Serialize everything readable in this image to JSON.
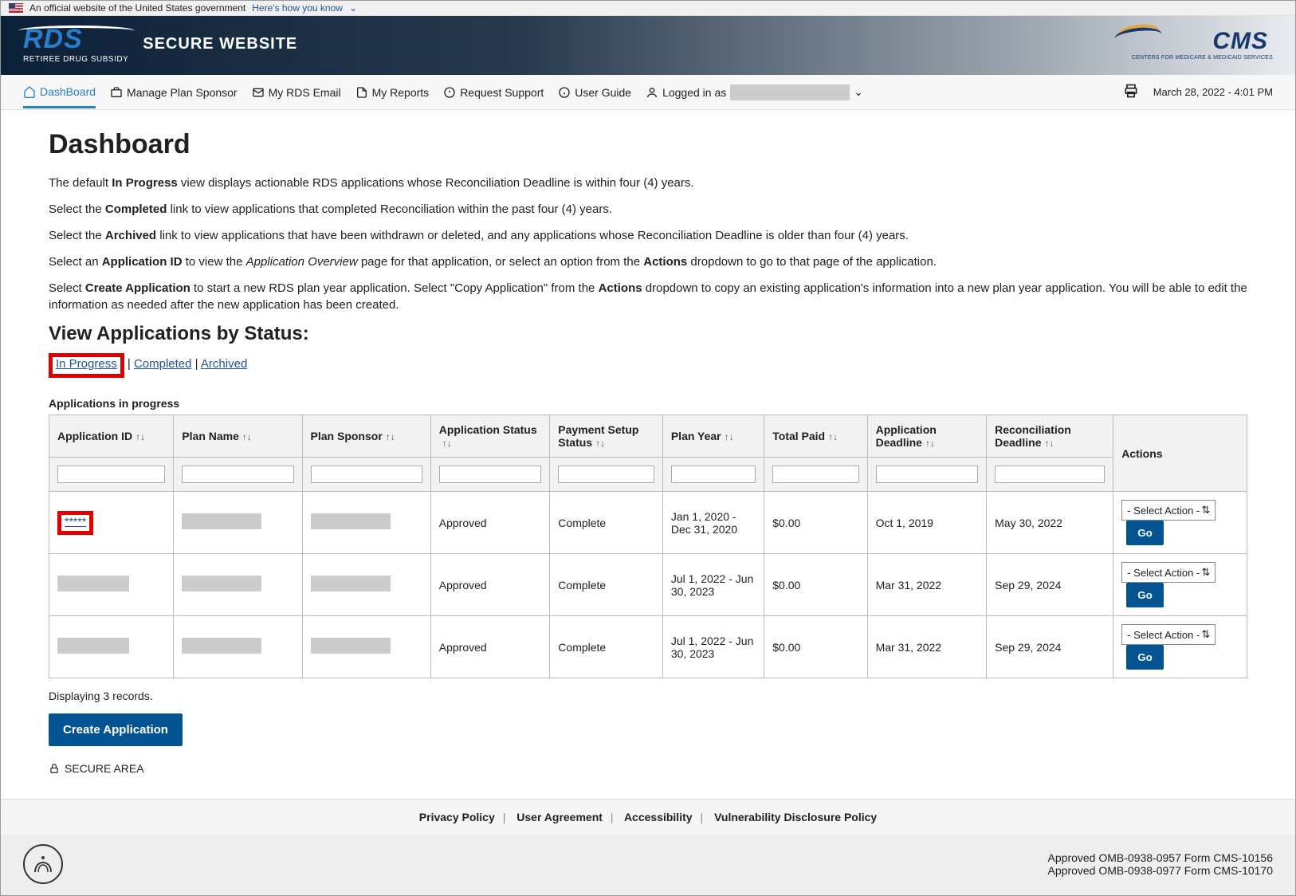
{
  "banner": {
    "official": "An official website of the United States government",
    "how": "Here's how you know"
  },
  "brand": {
    "logo_main": "RDS",
    "logo_sub": "RETIREE DRUG SUBSIDY",
    "site": "SECURE WEBSITE",
    "cms": "CMS",
    "cms_tag": "CENTERS FOR MEDICARE & MEDICAID SERVICES"
  },
  "nav": {
    "dashboard": "DashBoard",
    "manage": "Manage Plan Sponsor",
    "email": "My RDS Email",
    "reports": "My Reports",
    "support": "Request Support",
    "guide": "User Guide",
    "logged": "Logged in as",
    "timestamp": "March 28, 2022 - 4:01 PM"
  },
  "dash": {
    "title": "Dashboard",
    "p1a": "The default ",
    "p1b": "In Progress",
    "p1c": " view displays actionable RDS applications whose Reconciliation Deadline is within four (4) years.",
    "p2a": "Select the ",
    "p2b": "Completed",
    "p2c": " link to view applications that completed Reconciliation within the past four (4) years.",
    "p3a": "Select the ",
    "p3b": "Archived",
    "p3c": " link to view applications that have been withdrawn or deleted, and any applications whose Reconciliation Deadline is older than four (4) years.",
    "p4a": "Select an ",
    "p4b": "Application ID",
    "p4c": " to view the ",
    "p4d": "Application Overview",
    "p4e": " page for that application, or select an option from the ",
    "p4f": "Actions",
    "p4g": " dropdown to go to that page of the application.",
    "p5a": "Select ",
    "p5b": "Create Application",
    "p5c": " to start a new RDS plan year application. Select \"Copy Application\" from the ",
    "p5d": "Actions",
    "p5e": " dropdown to copy an existing application's information into a new plan year application. You will be able to edit the information as needed after the new application has been created.",
    "view_h": "View Applications by Status:",
    "links": {
      "inprog": "In Progress",
      "completed": "Completed",
      "archived": "Archived"
    },
    "caption": "Applications in progress"
  },
  "table": {
    "headers": {
      "appid": "Application ID",
      "plan": "Plan Name",
      "sponsor": "Plan Sponsor",
      "appstatus": "Application Status",
      "paystatus": "Payment Setup Status",
      "year": "Plan Year",
      "paid": "Total Paid",
      "appdead": "Application Deadline",
      "recdead": "Reconciliation Deadline",
      "actions": "Actions"
    },
    "select_placeholder": "- Select Action -",
    "go": "Go",
    "rows": [
      {
        "id": "*****",
        "status": "Approved",
        "pay": "Complete",
        "year": "Jan 1, 2020 - Dec 31, 2020",
        "paid": "$0.00",
        "appdead": "Oct 1, 2019",
        "recdead": "May 30, 2022"
      },
      {
        "id": "",
        "status": "Approved",
        "pay": "Complete",
        "year": "Jul 1, 2022 - Jun 30, 2023",
        "paid": "$0.00",
        "appdead": "Mar 31, 2022",
        "recdead": "Sep 29, 2024"
      },
      {
        "id": "",
        "status": "Approved",
        "pay": "Complete",
        "year": "Jul 1, 2022 - Jun 30, 2023",
        "paid": "$0.00",
        "appdead": "Mar 31, 2022",
        "recdead": "Sep 29, 2024"
      }
    ]
  },
  "footer": {
    "records": "Displaying 3 records.",
    "create": "Create Application",
    "secure": "SECURE AREA",
    "privacy": "Privacy Policy",
    "agreement": "User Agreement",
    "access": "Accessibility",
    "vuln": "Vulnerability Disclosure Policy",
    "omb1": "Approved OMB-0938-0957 Form CMS-10156",
    "omb2": "Approved OMB-0938-0977 Form CMS-10170"
  }
}
